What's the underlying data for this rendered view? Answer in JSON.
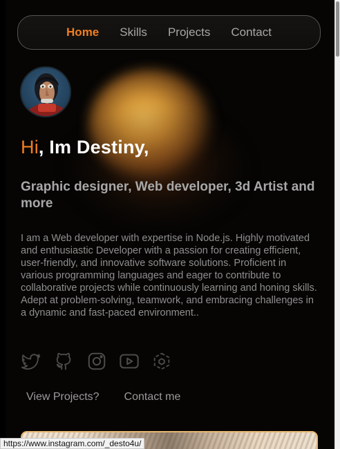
{
  "nav": {
    "items": [
      "Home",
      "Skills",
      "Projects",
      "Contact"
    ],
    "active": "Home"
  },
  "hero": {
    "greeting_hi": "Hi",
    "greeting_rest": ", Im Destiny,",
    "subtitle": "Graphic designer, Web developer, 3d Artist and more",
    "about": "I am a Web developer with expertise in Node.js. Highly motivated and enthusiastic Developer with a passion for creating efficient, user-friendly, and innovative software solutions. Proficient in various programming languages and eager to contribute to collaborative projects while continuously learning and honing skills. Adept at problem-solving, teamwork, and embracing challenges in a dynamic and fast-paced environment.."
  },
  "socials": [
    {
      "icon": "twitter-icon"
    },
    {
      "icon": "github-icon"
    },
    {
      "icon": "instagram-icon"
    },
    {
      "icon": "youtube-icon"
    },
    {
      "icon": "codepen-icon"
    }
  ],
  "ctas": {
    "projects": "View Projects?",
    "contact": "Contact me"
  },
  "status_bar": {
    "url": "https://www.instagram.com/_desto4u/"
  },
  "colors": {
    "accent": "#f37d1f",
    "text": "#ffffff",
    "muted": "#a8a8a8",
    "background": "#060504",
    "card_border": "#e7b770"
  }
}
